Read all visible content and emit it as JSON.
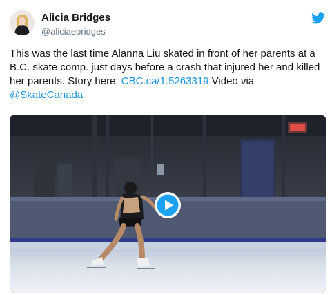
{
  "author": {
    "name": "Alicia Bridges",
    "handle": "@aliciaebridges"
  },
  "tweet": {
    "text": "This was the last time Alanna Liu skated in front of her parents at a B.C. skate comp. just days before a crash that injured her and killed her parents. Story here: ",
    "link": "CBC.ca/1.5263319",
    "text_after_link": " Video via ",
    "mention": "@SkateCanada"
  },
  "icons": {
    "brand": "twitter-bird-icon",
    "play": "play-icon"
  },
  "colors": {
    "link": "#1b95e0",
    "twitter_blue": "#1da1f2",
    "play": "#1da1f2"
  }
}
